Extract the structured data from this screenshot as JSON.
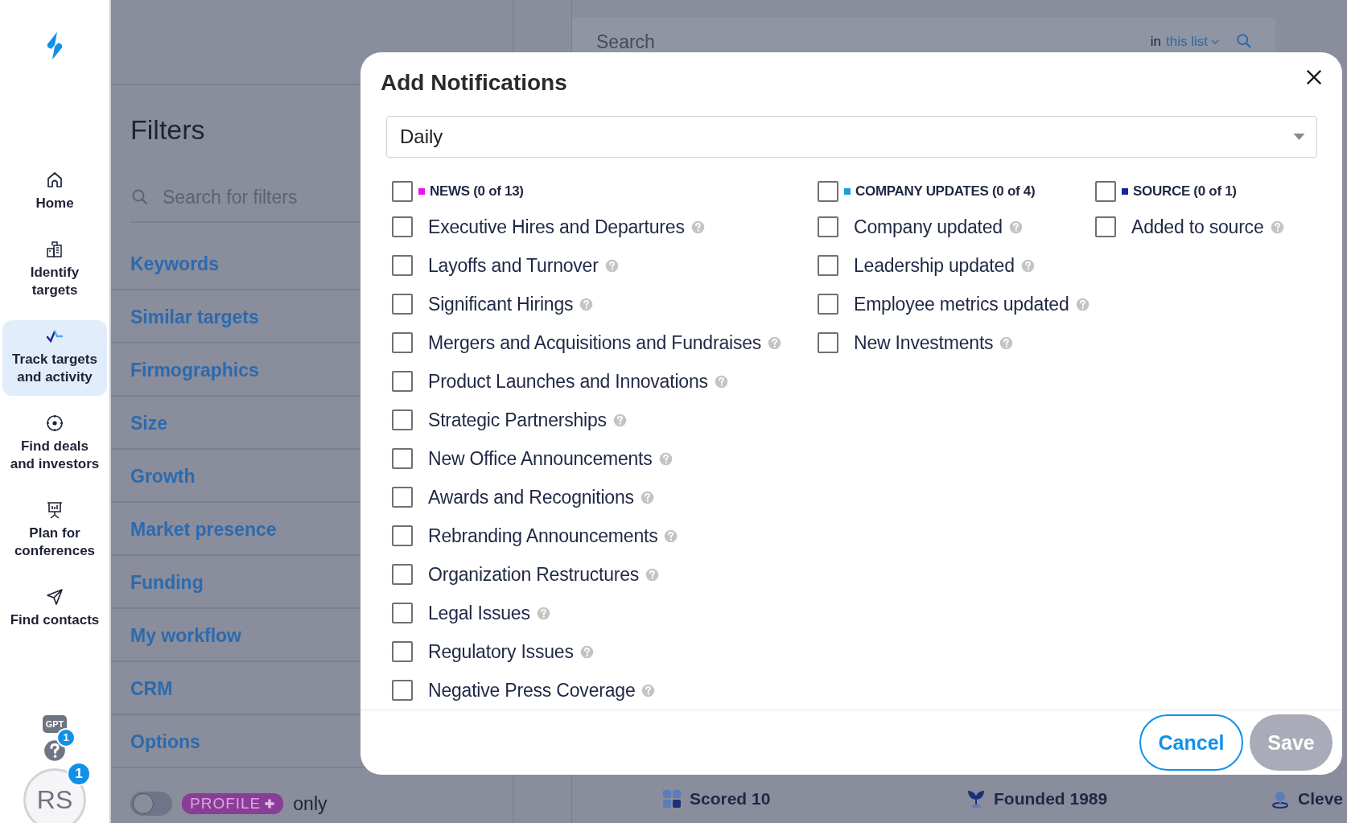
{
  "nav": [
    {
      "label": "Home",
      "selected": false
    },
    {
      "label": "Identify targets",
      "selected": false
    },
    {
      "label": "Track targets and activity",
      "selected": true
    },
    {
      "label": "Find deals and investors",
      "selected": false
    },
    {
      "label": "Plan for conferences",
      "selected": false
    },
    {
      "label": "Find contacts",
      "selected": false
    }
  ],
  "nav_bottom": {
    "gpt": "GPT",
    "help_badge": "1",
    "avatar": "RS",
    "avatar_badge": "1"
  },
  "filters": {
    "title": "Filters",
    "search_placeholder": "Search for filters",
    "items": [
      "Keywords",
      "Similar targets",
      "Firmographics",
      "Size",
      "Growth",
      "Market presence",
      "Funding",
      "My workflow",
      "CRM",
      "Options"
    ],
    "toggle_on": false,
    "badge": "PROFILE",
    "only": "only"
  },
  "search": {
    "placeholder": "Search",
    "scope_prefix": "in",
    "scope": "this list"
  },
  "summary": [
    "Scored 10",
    "Founded 1989",
    "Cleve"
  ],
  "modal": {
    "title": "Add Notifications",
    "frequency": "Daily",
    "groups": [
      {
        "label": "NEWS (0 of 13)",
        "color": "#e815e8",
        "checked": false,
        "items": [
          {
            "label": "Executive Hires and Departures",
            "checked": false
          },
          {
            "label": "Layoffs and Turnover",
            "checked": false
          },
          {
            "label": "Significant Hirings",
            "checked": false
          },
          {
            "label": "Mergers and Acquisitions and Fundraises",
            "checked": false
          },
          {
            "label": "Product Launches and Innovations",
            "checked": false
          },
          {
            "label": "Strategic Partnerships",
            "checked": false
          },
          {
            "label": "New Office Announcements",
            "checked": false
          },
          {
            "label": "Awards and Recognitions",
            "checked": false
          },
          {
            "label": "Rebranding Announcements",
            "checked": false
          },
          {
            "label": "Organization Restructures",
            "checked": false
          },
          {
            "label": "Legal Issues",
            "checked": false
          },
          {
            "label": "Regulatory Issues",
            "checked": false
          },
          {
            "label": "Negative Press Coverage",
            "checked": false
          }
        ]
      },
      {
        "label": "COMPANY UPDATES (0 of 4)",
        "color": "#1a9be8",
        "checked": false,
        "items": [
          {
            "label": "Company updated",
            "checked": false
          },
          {
            "label": "Leadership updated",
            "checked": false
          },
          {
            "label": "Employee metrics updated",
            "checked": false
          },
          {
            "label": "New Investments",
            "checked": false
          }
        ]
      },
      {
        "label": "SOURCE (0 of 1)",
        "color": "#16269a",
        "checked": false,
        "items": [
          {
            "label": "Added to source",
            "checked": false
          }
        ]
      }
    ],
    "cancel": "Cancel",
    "save": "Save",
    "save_disabled": true
  }
}
